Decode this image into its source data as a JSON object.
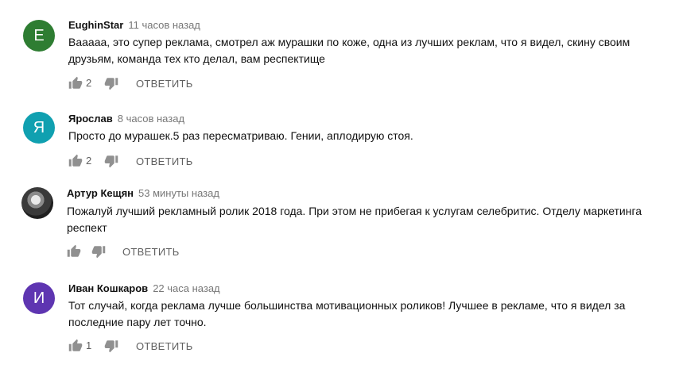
{
  "colors": {
    "avatar_e": "#2e7d32",
    "avatar_ya": "#10a0b0",
    "avatar_i": "#5e35b1",
    "icon_gray": "#909090"
  },
  "comments": [
    {
      "avatar_letter": "E",
      "author": "EughinStar",
      "time": "11 часов назад",
      "text": "Вааааа, это супер реклама, смотрел аж мурашки по коже, одна из лучших реклам, что я видел, скину своим друзьям, команда тех кто делал, вам респектище",
      "likes": "2",
      "reply_label": "ОТВЕТИТЬ"
    },
    {
      "avatar_letter": "Я",
      "author": "Ярослав",
      "time": "8 часов назад",
      "text": "Просто до мурашек.5 раз пересматриваю. Гении, аплодирую стоя.",
      "likes": "2",
      "reply_label": "ОТВЕТИТЬ"
    },
    {
      "avatar_letter": "",
      "author": "Артур Кещян",
      "time": "53 минуты назад",
      "text": "Пожалуй лучший рекламный ролик 2018 года. При этом не прибегая к услугам селебритис. Отделу маркетинга респект",
      "likes": "",
      "reply_label": "ОТВЕТИТЬ"
    },
    {
      "avatar_letter": "И",
      "author": "Иван Кошкаров",
      "time": "22 часа назад",
      "text": "Тот случай, когда реклама лучше большинства мотивационных роликов! Лучшее в рекламе, что  я видел за последние пару лет точно.",
      "likes": "1",
      "reply_label": "ОТВЕТИТЬ"
    }
  ]
}
